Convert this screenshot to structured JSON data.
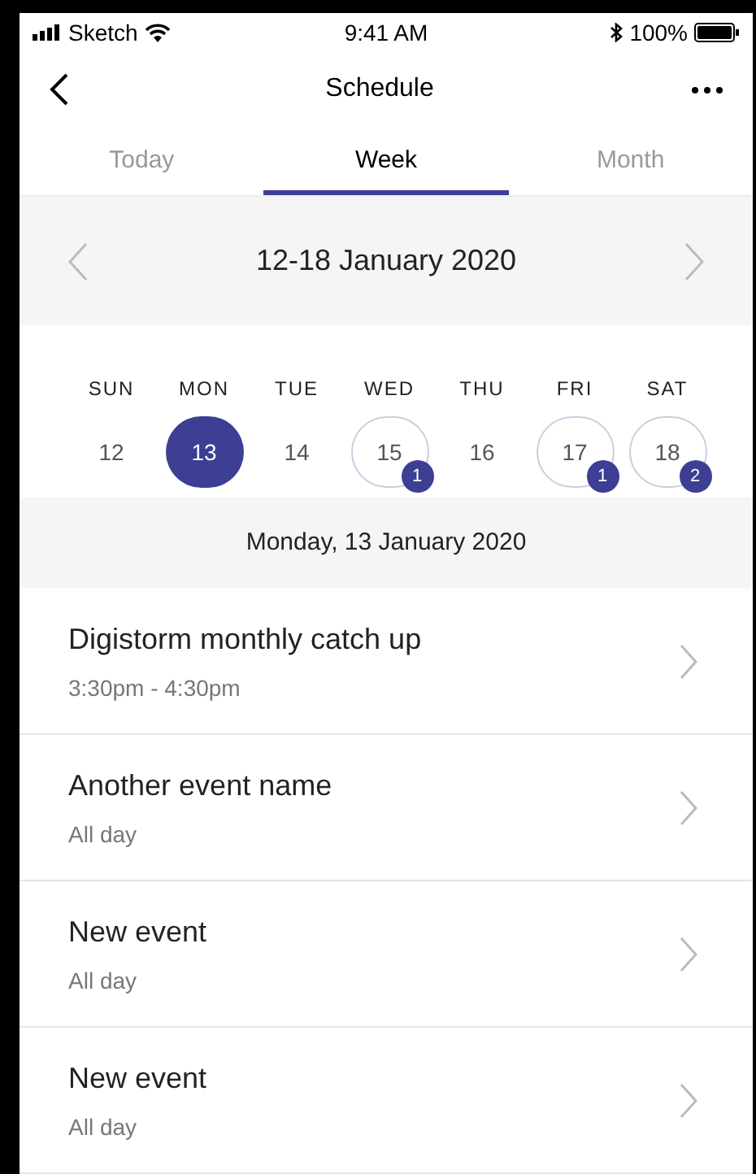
{
  "status_bar": {
    "carrier": "Sketch",
    "time": "9:41 AM",
    "battery": "100%"
  },
  "header": {
    "title": "Schedule"
  },
  "tabs": [
    {
      "label": "Today",
      "selected": false
    },
    {
      "label": "Week",
      "selected": true
    },
    {
      "label": "Month",
      "selected": false
    }
  ],
  "week_nav": {
    "range": "12-18 January 2020"
  },
  "days": [
    {
      "weekday": "SUN",
      "date": "12",
      "selected": false
    },
    {
      "weekday": "MON",
      "date": "13",
      "selected": true
    },
    {
      "weekday": "TUE",
      "date": "14",
      "selected": false
    },
    {
      "weekday": "WED",
      "date": "15",
      "selected": false,
      "count": "1"
    },
    {
      "weekday": "THU",
      "date": "16",
      "selected": false
    },
    {
      "weekday": "FRI",
      "date": "17",
      "selected": false,
      "count": "1"
    },
    {
      "weekday": "SAT",
      "date": "18",
      "selected": false,
      "count": "2"
    }
  ],
  "day_heading": "Monday, 13 January 2020",
  "events": [
    {
      "title": "Digistorm monthly catch up",
      "time": "3:30pm - 4:30pm"
    },
    {
      "title": "Another event name",
      "time": "All day"
    },
    {
      "title": "New event",
      "time": "All day"
    },
    {
      "title": "New event",
      "time": "All day"
    }
  ]
}
